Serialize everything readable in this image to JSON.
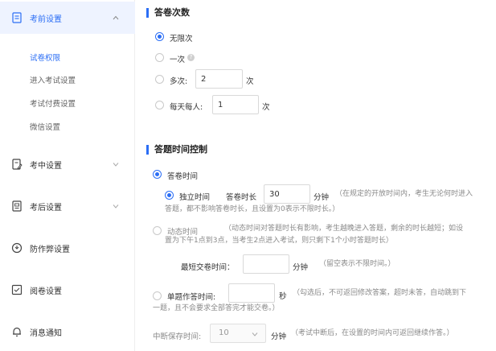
{
  "sidebar": {
    "groups": [
      {
        "label": "考前设置",
        "icon": "exam-doc-icon",
        "expanded": true
      },
      {
        "label": "考中设置",
        "icon": "edit-doc-icon"
      },
      {
        "label": "考后设置",
        "icon": "report-icon"
      },
      {
        "label": "防作弊设置",
        "icon": "shield-icon"
      },
      {
        "label": "阅卷设置",
        "icon": "grading-icon"
      },
      {
        "label": "消息通知",
        "icon": "bell-icon"
      }
    ],
    "subitems": [
      "试卷权限",
      "进入考试设置",
      "考试付费设置",
      "微信设置"
    ],
    "active_subitem": "试卷权限"
  },
  "attempts": {
    "title": "答卷次数",
    "unlimited_label": "无限次",
    "once_label": "一次",
    "multi_label": "多次:",
    "multi_value": "2",
    "multi_unit": "次",
    "daily_label": "每天每人:",
    "daily_value": "1",
    "daily_unit": "次",
    "selected": "unlimited"
  },
  "time_control": {
    "title": "答题时间控制",
    "answer_time_label": "答卷时间",
    "independent_label": "独立时间",
    "duration_label": "答卷时长",
    "duration_value": "30",
    "duration_unit": "分钟",
    "independent_note_1": "（在规定的开放时间内，考生无论何时进入",
    "independent_note_2": "答题，都不影响答卷时长，且设置为0表示不限时长。）",
    "dynamic_label": "动态时间",
    "dynamic_note_1": "（动态时间对答题时长有影响，考生越晚进入答题，剩余的时长越短；如设",
    "dynamic_note_2": "置为下午1点到3点，当考生2点进入考试，则只剩下1个小时答题时长）",
    "min_submit_label": "最短交卷时间：",
    "min_submit_value": "",
    "min_submit_unit": "分钟",
    "min_submit_note": "（留空表示不限时间。）",
    "per_question_label": "单题作答时间:",
    "per_question_value": "",
    "per_question_unit": "秒",
    "per_question_note_1": "（勾选后，不可返回修改答案，超时未答，自动跳到下",
    "per_question_note_2": "一题，且不会要求全部答完才能交卷。）",
    "interrupt_label": "中断保存时间:",
    "interrupt_value": "10",
    "interrupt_unit": "分钟",
    "interrupt_note": "（考试中断后，在设置的时间内可返回继续作答。）"
  },
  "colors": {
    "accent": "#2b6ef5",
    "active_bg": "#eef3ff"
  }
}
